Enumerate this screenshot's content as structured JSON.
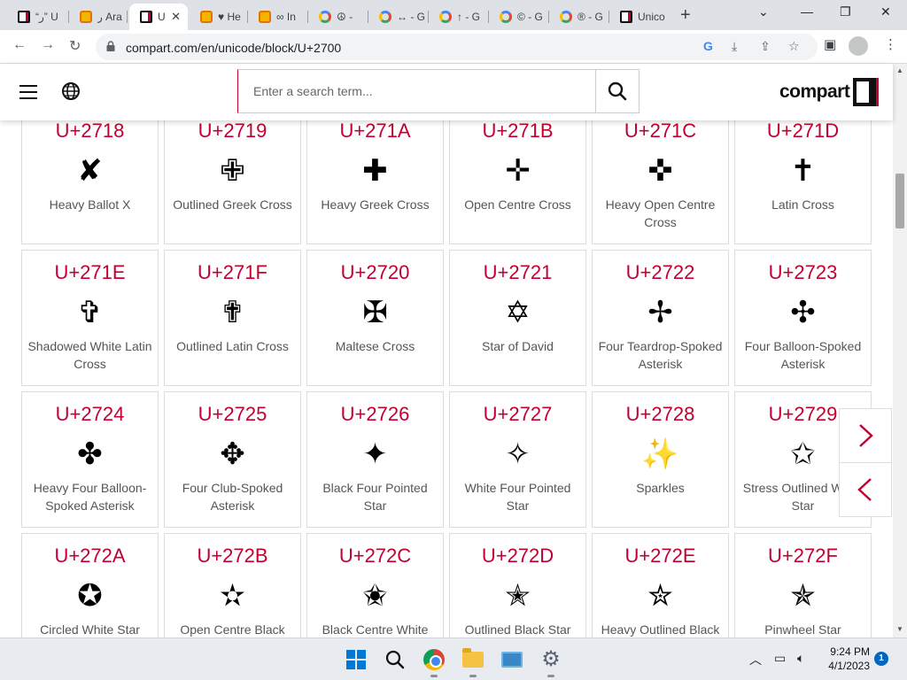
{
  "browser": {
    "tabs": [
      {
        "title": "“ﺭ” U",
        "favicon": "compart-favicon"
      },
      {
        "title": "ﺭ Ara",
        "favicon": "orange-favicon"
      },
      {
        "title": "U",
        "favicon": "compart-favicon",
        "active": true
      },
      {
        "title": "♥ He",
        "favicon": "orange-favicon"
      },
      {
        "title": "∞ In",
        "favicon": "orange-favicon"
      },
      {
        "title": "☮ -",
        "favicon": "google-favicon"
      },
      {
        "title": "↔ - G",
        "favicon": "google-favicon"
      },
      {
        "title": "↑ - G",
        "favicon": "google-favicon"
      },
      {
        "title": "© - G",
        "favicon": "google-favicon"
      },
      {
        "title": "® - G",
        "favicon": "google-favicon"
      },
      {
        "title": "Unico",
        "favicon": "compart-favicon"
      }
    ],
    "url": "compart.com/en/unicode/block/U+2700"
  },
  "header": {
    "search_placeholder": "Enter a search term...",
    "logo_text": "compart"
  },
  "grid": {
    "rows": [
      [
        {
          "code": "U+2718",
          "glyph": "✘",
          "name": "Heavy Ballot X"
        },
        {
          "code": "U+2719",
          "glyph": "✙",
          "name": "Outlined Greek Cross"
        },
        {
          "code": "U+271A",
          "glyph": "✚",
          "name": "Heavy Greek Cross"
        },
        {
          "code": "U+271B",
          "glyph": "✛",
          "name": "Open Centre Cross"
        },
        {
          "code": "U+271C",
          "glyph": "✜",
          "name": "Heavy Open Centre Cross"
        },
        {
          "code": "U+271D",
          "glyph": "✝",
          "name": "Latin Cross"
        }
      ],
      [
        {
          "code": "U+271E",
          "glyph": "✞",
          "name": "Shadowed White Latin Cross"
        },
        {
          "code": "U+271F",
          "glyph": "✟",
          "name": "Outlined Latin Cross"
        },
        {
          "code": "U+2720",
          "glyph": "✠",
          "name": "Maltese Cross"
        },
        {
          "code": "U+2721",
          "glyph": "✡",
          "name": "Star of David"
        },
        {
          "code": "U+2722",
          "glyph": "✢",
          "name": "Four Teardrop-Spoked Asterisk"
        },
        {
          "code": "U+2723",
          "glyph": "✣",
          "name": "Four Balloon-Spoked Asterisk"
        }
      ],
      [
        {
          "code": "U+2724",
          "glyph": "✤",
          "name": "Heavy Four Balloon-Spoked Asterisk"
        },
        {
          "code": "U+2725",
          "glyph": "✥",
          "name": "Four Club-Spoked Asterisk"
        },
        {
          "code": "U+2726",
          "glyph": "✦",
          "name": "Black Four Pointed Star"
        },
        {
          "code": "U+2727",
          "glyph": "✧",
          "name": "White Four Pointed Star"
        },
        {
          "code": "U+2728",
          "glyph": "✨",
          "name": "Sparkles",
          "emoji": true
        },
        {
          "code": "U+2729",
          "glyph": "✩",
          "name": "Stress Outlined White Star"
        }
      ],
      [
        {
          "code": "U+272A",
          "glyph": "✪",
          "name": "Circled White Star"
        },
        {
          "code": "U+272B",
          "glyph": "✫",
          "name": "Open Centre Black Star"
        },
        {
          "code": "U+272C",
          "glyph": "✬",
          "name": "Black Centre White Star"
        },
        {
          "code": "U+272D",
          "glyph": "✭",
          "name": "Outlined Black Star"
        },
        {
          "code": "U+272E",
          "glyph": "✮",
          "name": "Heavy Outlined Black Star"
        },
        {
          "code": "U+272F",
          "glyph": "✯",
          "name": "Pinwheel Star"
        }
      ]
    ]
  },
  "taskbar": {
    "time": "9:24 PM",
    "date": "4/1/2023",
    "notification_count": "1"
  },
  "colors": {
    "accent": "#c3002f",
    "tab_strip": "#dee1e6"
  }
}
